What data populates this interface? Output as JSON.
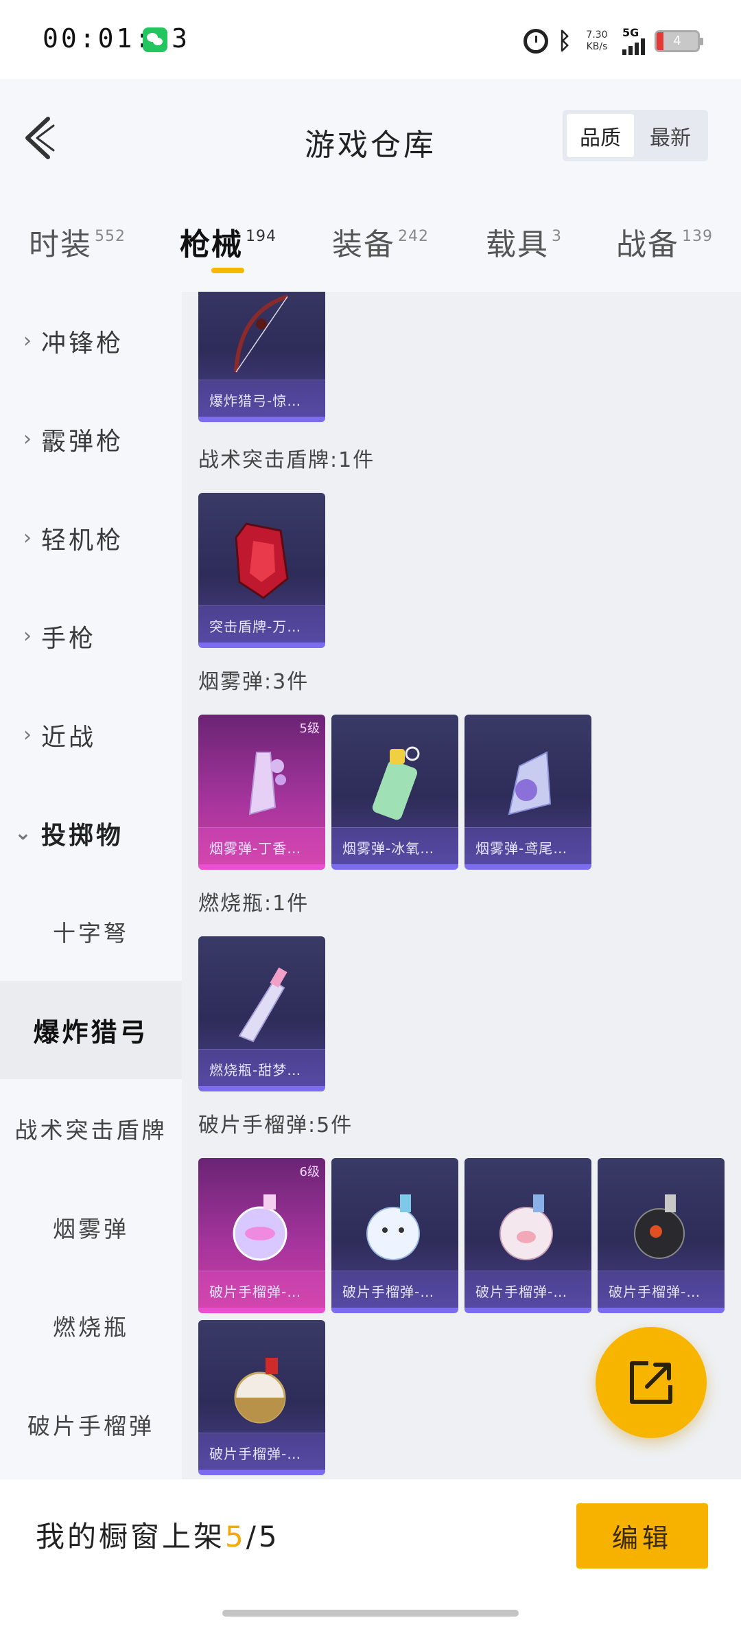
{
  "status_bar": {
    "time": "00:01:13",
    "net_speed_value": "7.30",
    "net_speed_unit": "KB/s",
    "network": "5G",
    "battery": "4",
    "icons": [
      "wechat-icon",
      "alarm-icon",
      "bluetooth-icon",
      "signal-icon",
      "battery-icon"
    ]
  },
  "header": {
    "title": "游戏仓库",
    "sort_options": [
      "品质",
      "最新"
    ],
    "active_sort": "品质"
  },
  "tabs": [
    {
      "label": "时装",
      "count": "552"
    },
    {
      "label": "枪械",
      "count": "194"
    },
    {
      "label": "装备",
      "count": "242"
    },
    {
      "label": "载具",
      "count": "3"
    },
    {
      "label": "战备",
      "count": "139"
    }
  ],
  "active_tab": "枪械",
  "sidebar": {
    "categories": [
      {
        "label": "冲锋枪",
        "expanded": false
      },
      {
        "label": "霰弹枪",
        "expanded": false
      },
      {
        "label": "轻机枪",
        "expanded": false
      },
      {
        "label": "手枪",
        "expanded": false
      },
      {
        "label": "近战",
        "expanded": false
      },
      {
        "label": "投掷物",
        "expanded": true
      }
    ],
    "sub_items": [
      "十字弩",
      "爆炸猎弓",
      "战术突击盾牌",
      "烟雾弹",
      "燃烧瓶",
      "破片手榴弹"
    ],
    "active_sub_item": "爆炸猎弓"
  },
  "content": {
    "groups": [
      {
        "title": "",
        "items": [
          {
            "name": "爆炸猎弓-惊…",
            "level": "",
            "quality": "purple"
          }
        ]
      },
      {
        "title": "战术突击盾牌:1件",
        "items": [
          {
            "name": "突击盾牌-万…",
            "level": "",
            "quality": "purple"
          }
        ]
      },
      {
        "title": "烟雾弹:3件",
        "items": [
          {
            "name": "烟雾弹-丁香…",
            "level": "5级",
            "quality": "pink"
          },
          {
            "name": "烟雾弹-冰氧…",
            "level": "",
            "quality": "purple"
          },
          {
            "name": "烟雾弹-鸢尾…",
            "level": "",
            "quality": "purple"
          }
        ]
      },
      {
        "title": "燃烧瓶:1件",
        "items": [
          {
            "name": "燃烧瓶-甜梦…",
            "level": "",
            "quality": "purple"
          }
        ]
      },
      {
        "title": "破片手榴弹:5件",
        "items": [
          {
            "name": "破片手榴弹-…",
            "level": "6级",
            "quality": "pink"
          },
          {
            "name": "破片手榴弹-…",
            "level": "",
            "quality": "purple"
          },
          {
            "name": "破片手榴弹-…",
            "level": "",
            "quality": "purple"
          },
          {
            "name": "破片手榴弹-…",
            "level": "",
            "quality": "purple"
          },
          {
            "name": "破片手榴弹-…",
            "level": "",
            "quality": "purple"
          }
        ]
      }
    ]
  },
  "share_button_icon": "share-external-icon",
  "bottom_bar": {
    "shelf_label": "我的橱窗上架",
    "shelf_current": "5",
    "shelf_total": "/5",
    "edit_label": "编辑"
  },
  "colors": {
    "accent": "#f7b200",
    "card_purple": "#3a3a66",
    "card_pink": "#a8359e"
  }
}
